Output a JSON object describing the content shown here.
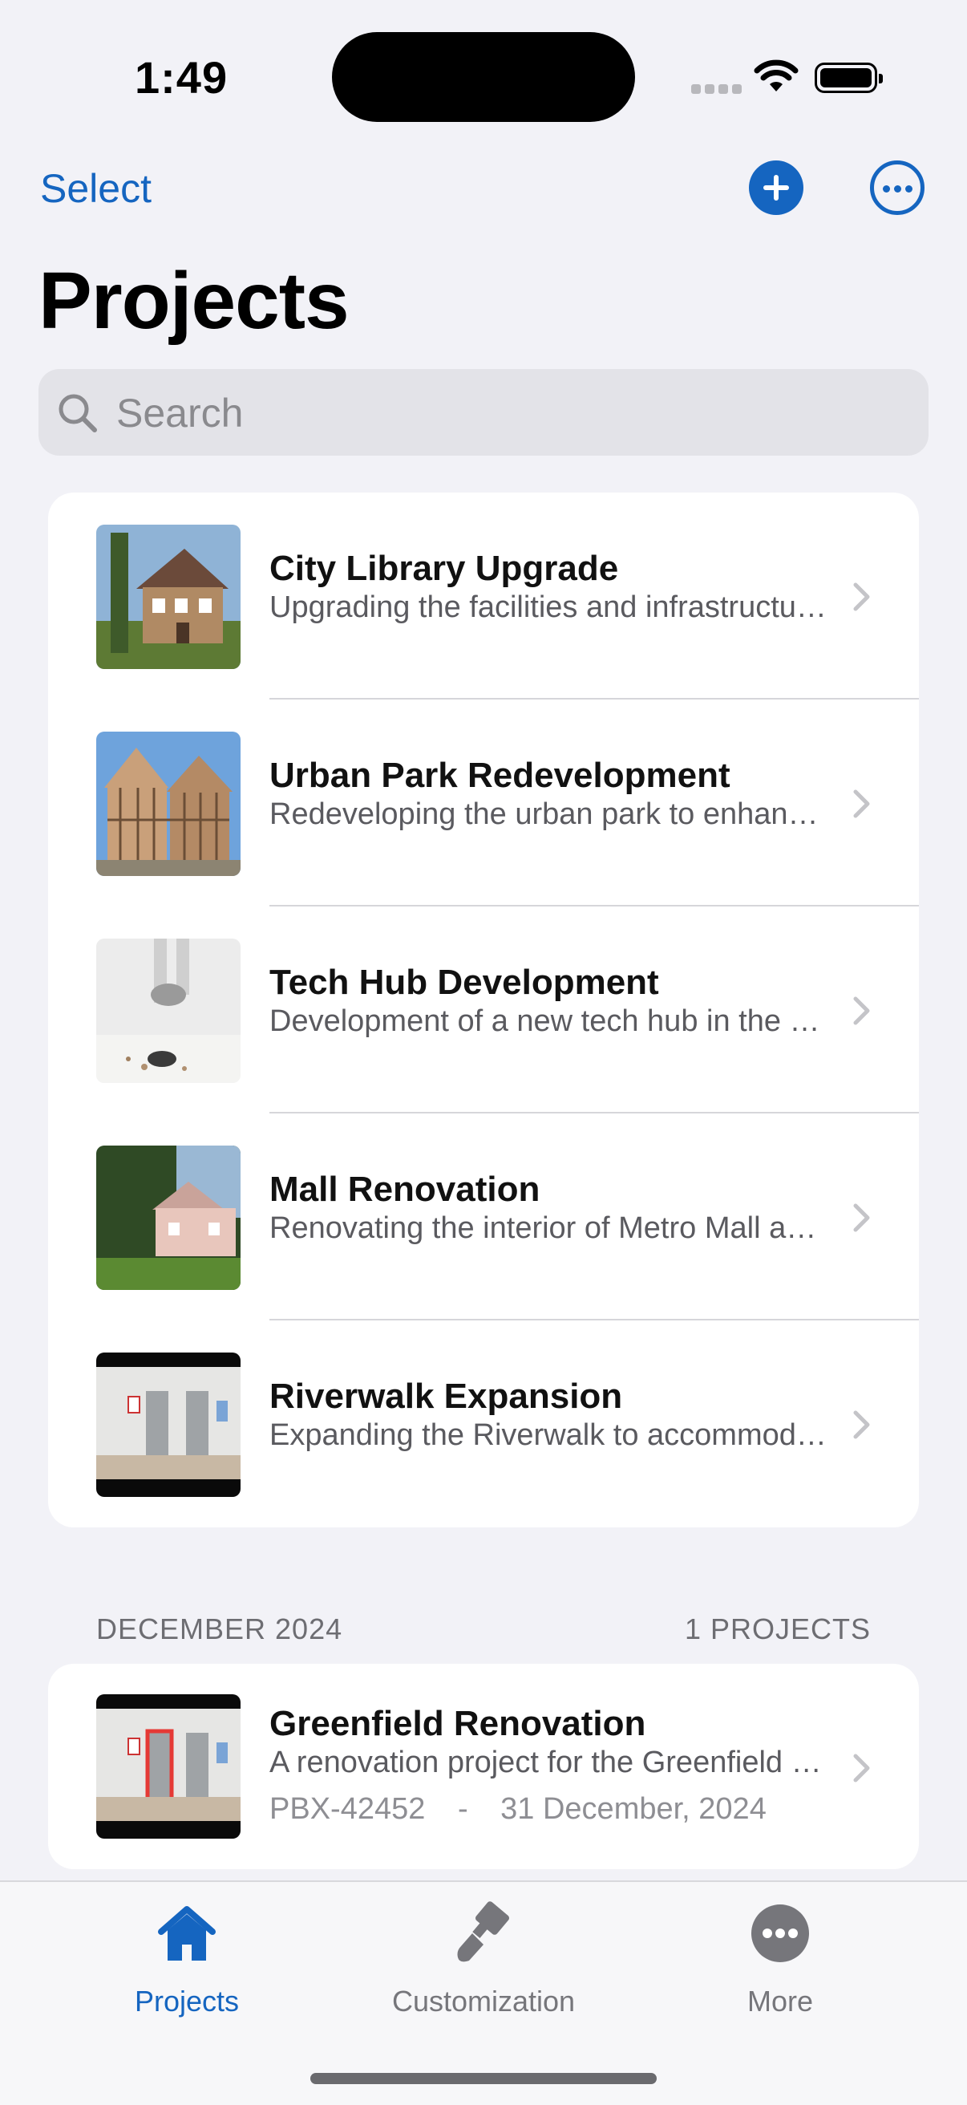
{
  "status_bar": {
    "time": "1:49"
  },
  "nav": {
    "select_label": "Select",
    "title": "Projects"
  },
  "search": {
    "placeholder": "Search"
  },
  "projects": [
    {
      "title": "City Library Upgrade",
      "subtitle": "Upgrading the facilities and infrastructure of the City Library"
    },
    {
      "title": "Urban Park Redevelopment",
      "subtitle": "Redeveloping the urban park to enhance green spaces"
    },
    {
      "title": "Tech Hub Development",
      "subtitle": "Development of a new tech hub in the city"
    },
    {
      "title": "Mall Renovation",
      "subtitle": "Renovating the interior of Metro Mall and its surroundings"
    },
    {
      "title": "Riverwalk Expansion",
      "subtitle": "Expanding the Riverwalk to accommodate more visitors"
    }
  ],
  "section": {
    "header_left": "DECEMBER 2024",
    "header_right": "1 PROJECTS",
    "items": [
      {
        "title": "Greenfield Renovation",
        "subtitle": "A renovation project for the Greenfield community",
        "code": "PBX-42452",
        "separator": "-",
        "date": "31 December, 2024"
      }
    ]
  },
  "tabbar": {
    "items": [
      {
        "label": "Projects",
        "icon": "house-icon"
      },
      {
        "label": "Customization",
        "icon": "paintbrush-icon"
      },
      {
        "label": "More",
        "icon": "ellipsis-icon"
      }
    ],
    "active_color": "#1565c0",
    "inactive_color": "#76767b"
  },
  "colors": {
    "accent": "#1565c0",
    "background": "#f2f2f7"
  }
}
